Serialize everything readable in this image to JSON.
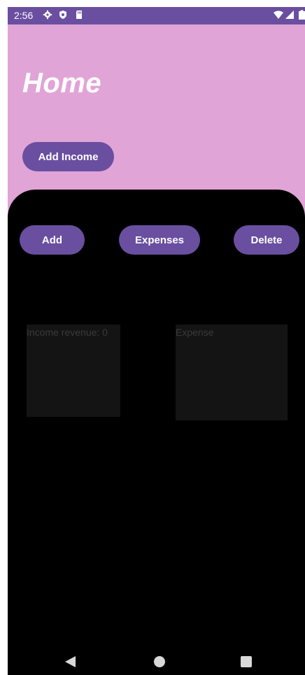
{
  "status_bar": {
    "time": "2:56",
    "icons": [
      "gear-icon",
      "shield-icon",
      "sd-card-icon",
      "wifi-icon",
      "signal-icon",
      "battery-icon"
    ]
  },
  "header": {
    "title": "Home",
    "add_income_label": "Add Income"
  },
  "actions": {
    "add_label": "Add",
    "expenses_label": "Expenses",
    "delete_label": "Delete"
  },
  "cards": {
    "income_text": "Income revenue: 0",
    "expense_text": "Expense"
  },
  "nav": {
    "icons": [
      "back-icon",
      "home-icon",
      "recents-icon"
    ]
  },
  "colors": {
    "accent": "#6a4fa0",
    "header_bg": "#e1a4d7",
    "body_bg": "#000000"
  }
}
